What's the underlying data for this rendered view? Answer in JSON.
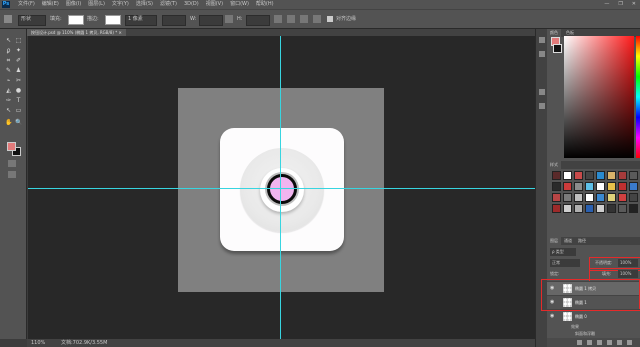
{
  "app": {
    "logo": "Ps"
  },
  "menu": [
    "文件(F)",
    "编辑(E)",
    "图像(I)",
    "图层(L)",
    "文字(Y)",
    "选择(S)",
    "滤镜(T)",
    "3D(D)",
    "视图(V)",
    "窗口(W)",
    "帮助(H)"
  ],
  "window_controls": [
    "—",
    "❐",
    "✕"
  ],
  "options_bar": {
    "shape_mode": "形状",
    "fill_label": "填充:",
    "stroke_label": "描边:",
    "stroke_width": "1 像素",
    "w_label": "W:",
    "h_label": "H:",
    "align_edges": "对齐边缘",
    "fill_color": "#ffffff",
    "stroke_color": "#ffffff"
  },
  "document": {
    "tab_title": "按钮设计.psd @ 110% (椭圆 1 拷贝, RGB/8) * ✕",
    "zoom": "110%",
    "doc_info": "文档:702.9K/3.55M"
  },
  "colors": {
    "foreground": "#e27a7a",
    "background": "#111111",
    "gem": "#f1b4ef",
    "guide": "#38d5e0"
  },
  "panels": {
    "color_tabs": [
      "颜色",
      "色板"
    ],
    "styles_tab": "样式",
    "styles_swatches": [
      "#5a2a2a",
      "#ffffff",
      "#c84a4a",
      "#444",
      "#2a8acf",
      "#d9b36a",
      "#a63b3b",
      "#5a5a5a",
      "#2a2a2a",
      "#cc3b3b",
      "#8c8c8c",
      "#5ec0e8",
      "#ffffff",
      "#e8c04a",
      "#c03030",
      "#3a7acb",
      "#b84545",
      "#7a7a7a",
      "#bfbfbf",
      "#ffffff",
      "#3a88d0",
      "#e0d27a",
      "#d04040",
      "#444",
      "#9e2a2a",
      "#cfcfcf",
      "#b0b0b0",
      "#2a60b0",
      "#cfcfcf",
      "#333",
      "#5a5a5a",
      "#222"
    ],
    "layers_tabs": [
      "图层",
      "通道",
      "路径"
    ],
    "filter_label": "ρ 类型",
    "blend_mode": "正常",
    "opacity_label": "不透明度:",
    "opacity_value": "100%",
    "lock_label": "锁定:",
    "fill_label": "填充:",
    "fill_value": "100%",
    "layers": [
      {
        "name": "椭圆 1 拷贝",
        "selected": true
      },
      {
        "name": "椭圆 1",
        "selected": false
      },
      {
        "name": "椭圆 0",
        "selected": false
      }
    ],
    "effects_label": "效果",
    "effect_item": "斜面和浮雕"
  },
  "tools": [
    "↖",
    "⬚",
    "ϼ",
    "✦",
    "⌗",
    "✐",
    "✎",
    "♟",
    "⌁",
    "✂",
    "◭",
    "●",
    "✑",
    "T",
    "↖",
    "▭",
    "✋",
    "🔍"
  ]
}
